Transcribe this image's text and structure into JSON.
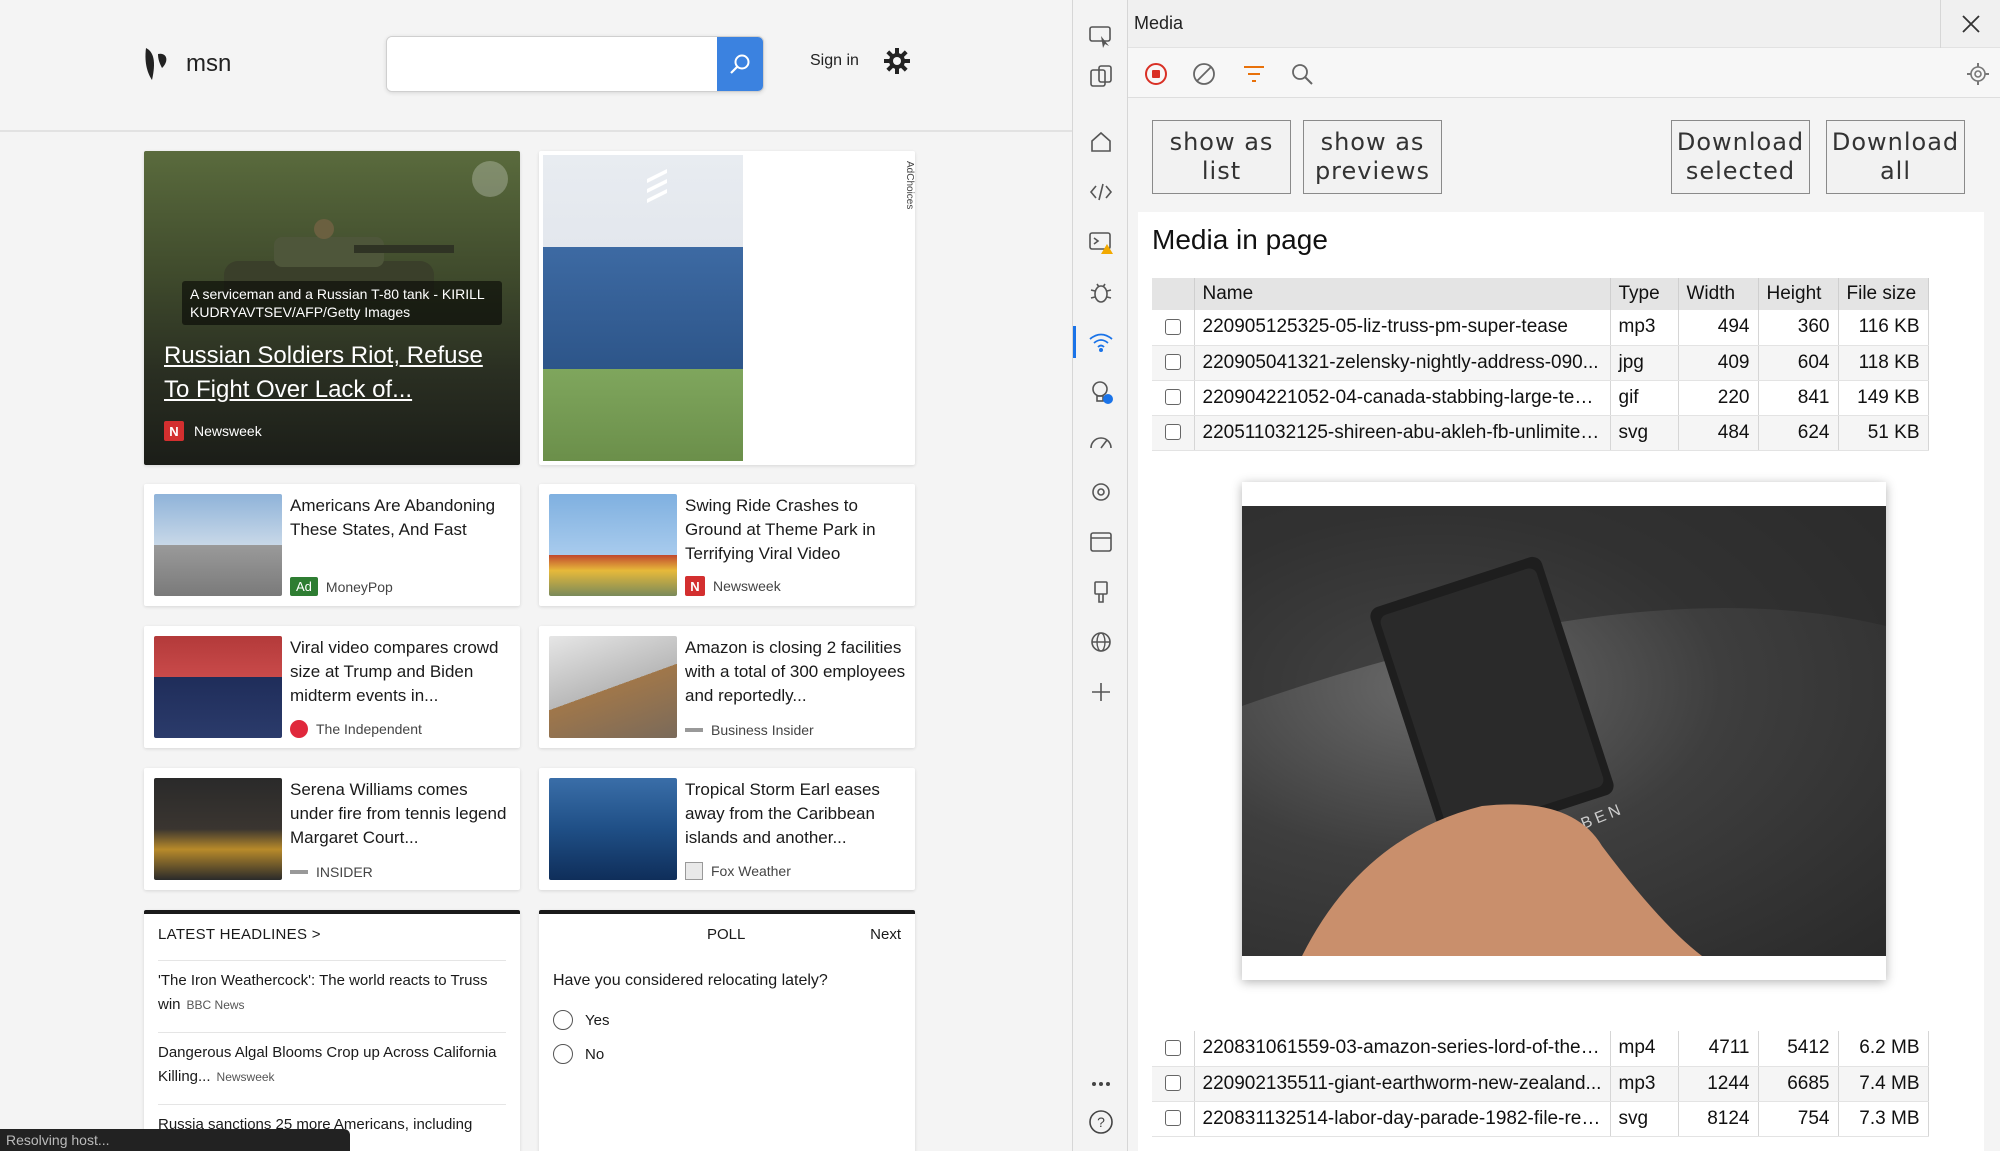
{
  "msn": {
    "logo_text": "msn",
    "search_placeholder": "",
    "signin": "Sign in",
    "hero": {
      "caption": "A serviceman and a Russian T-80 tank - KIRILL KUDRYAVTSEV/AFP/Getty Images",
      "title": "Russian Soldiers Riot, Refuse To Fight Over Lack of...",
      "source": "Newsweek"
    },
    "ad_choices": "AdChoices",
    "stories": [
      {
        "title": "Americans Are Abandoning These States, And Fast",
        "source": "MoneyPop",
        "ad": "Ad"
      },
      {
        "title": "Swing Ride Crashes to Ground at Theme Park in Terrifying Viral Video",
        "source": "Newsweek"
      },
      {
        "title": "Viral video compares crowd size at Trump and Biden midterm events in...",
        "source": "The Independent"
      },
      {
        "title": "Amazon is closing 2 facilities with a total of 300 employees and reportedly...",
        "source": "Business Insider"
      },
      {
        "title": "Serena Williams comes under fire from tennis legend Margaret Court...",
        "source": "INSIDER"
      },
      {
        "title": "Tropical Storm Earl eases away from the Caribbean islands and another...",
        "source": "Fox Weather"
      }
    ],
    "latest": {
      "title": "LATEST HEADLINES >",
      "items": [
        {
          "text": "'The Iron Weathercock': The world reacts to Truss win",
          "source": "BBC News"
        },
        {
          "text": "Dangerous Algal Blooms Crop up Across California Killing...",
          "source": "Newsweek"
        },
        {
          "text": "Russia sanctions 25 more Americans, including",
          "source": ""
        }
      ]
    },
    "poll": {
      "label": "POLL",
      "next": "Next",
      "question": "Have you considered relocating lately?",
      "options": [
        "Yes",
        "No"
      ]
    },
    "status": "Resolving host..."
  },
  "panel": {
    "title": "Media",
    "buttons": {
      "show_list": "show as list",
      "show_previews": "show as previews",
      "download_selected": "Download selected",
      "download_all": "Download all"
    },
    "heading": "Media in page",
    "columns": [
      "Name",
      "Type",
      "Width",
      "Height",
      "File size"
    ],
    "rows": [
      [
        "220905125325-05-liz-truss-pm-super-tease",
        "mp3",
        "494",
        "360",
        "116 KB"
      ],
      [
        "220905041321-zelensky-nightly-address-090...",
        "jpg",
        "409",
        "604",
        "118 KB"
      ],
      [
        "220904221052-04-canada-stabbing-large-tease",
        "gif",
        "220",
        "841",
        "149 KB"
      ],
      [
        "220511032125-shireen-abu-akleh-fb-unlimited...",
        "svg",
        "484",
        "624",
        "51 KB"
      ]
    ],
    "rows_bottom": [
      [
        "220831061559-03-amazon-series-lord-of-the-...",
        "mp4",
        "4711",
        "5412",
        "6.2 MB"
      ],
      [
        "220902135511-giant-earthworm-new-zealand...",
        "mp3",
        "1244",
        "6685",
        "7.4 MB"
      ],
      [
        "220831132514-labor-day-parade-1982-file-res...",
        "svg",
        "8124",
        "754",
        "7.3 MB"
      ]
    ],
    "preview_brand": "KARBEN"
  },
  "colors": {
    "accent": "#1a73e8",
    "search_btn": "#3b82e0",
    "record": "#d93025"
  }
}
